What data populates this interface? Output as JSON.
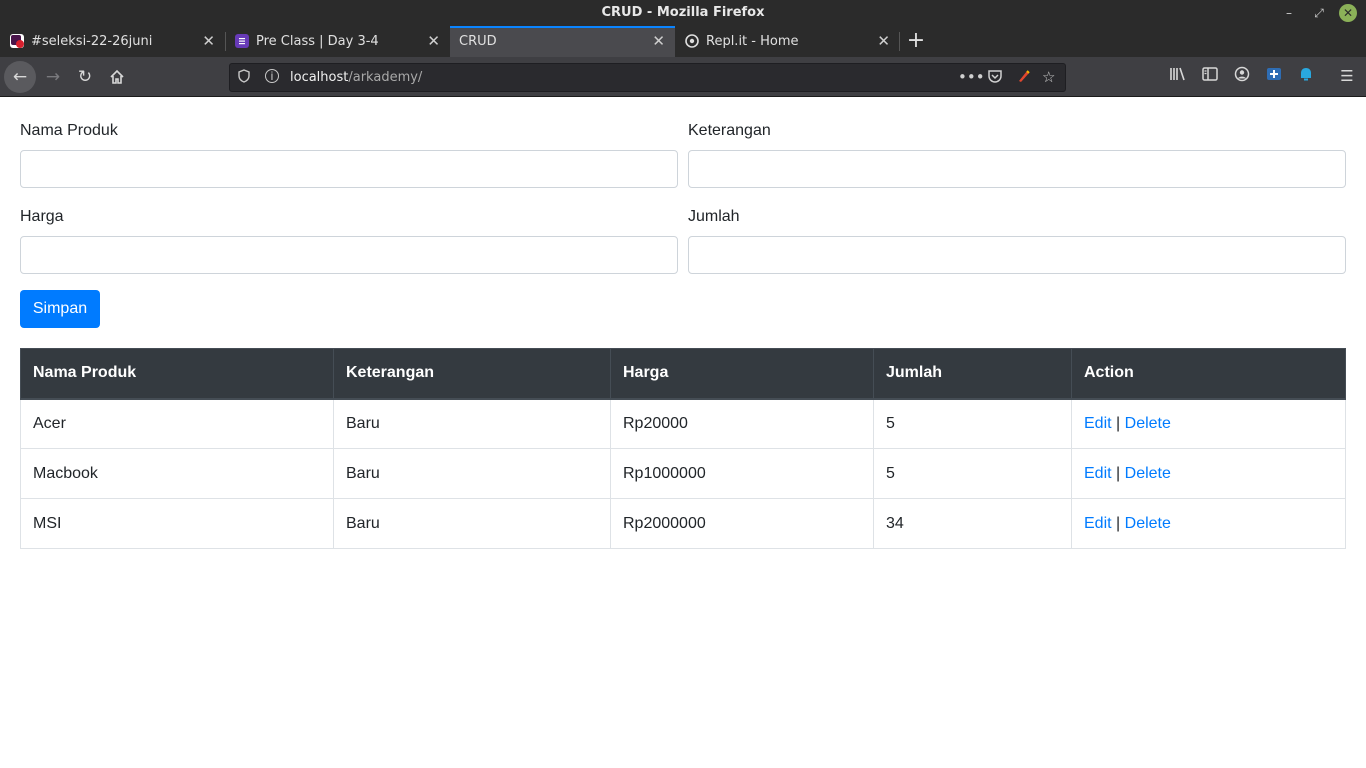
{
  "window": {
    "title": "CRUD - Mozilla Firefox",
    "controls": {
      "minimize": "–",
      "maximize": "⤢",
      "close": "✕"
    }
  },
  "tabs": [
    {
      "label": "#seleksi-22-26juni",
      "icon": "slack-channel-icon",
      "icon_color": "#d8202e"
    },
    {
      "label": "Pre Class | Day 3-4",
      "icon": "form-icon",
      "icon_color": "#673ab7"
    },
    {
      "label": "CRUD",
      "active": true
    },
    {
      "label": "Repl.it - Home",
      "icon": "replit-icon",
      "icon_color": "#dddddd"
    }
  ],
  "navbar": {
    "url_host": "localhost",
    "url_path": "/arkademy/",
    "library_badge": "0"
  },
  "form": {
    "fields": {
      "nama_produk": {
        "label": "Nama Produk",
        "value": ""
      },
      "keterangan": {
        "label": "Keterangan",
        "value": ""
      },
      "harga": {
        "label": "Harga",
        "value": ""
      },
      "jumlah": {
        "label": "Jumlah",
        "value": ""
      }
    },
    "submit_label": "Simpan"
  },
  "table": {
    "headers": [
      "Nama Produk",
      "Keterangan",
      "Harga",
      "Jumlah",
      "Action"
    ],
    "rows": [
      {
        "nama": "Acer",
        "keterangan": "Baru",
        "harga": "Rp20000",
        "jumlah": "5"
      },
      {
        "nama": "Macbook",
        "keterangan": "Baru",
        "harga": "Rp1000000",
        "jumlah": "5"
      },
      {
        "nama": "MSI",
        "keterangan": "Baru",
        "harga": "Rp2000000",
        "jumlah": "34"
      }
    ],
    "edit_label": "Edit",
    "separator": "|",
    "delete_label": "Delete"
  },
  "colors": {
    "primary": "#007bff",
    "table_header": "#343a40",
    "active_tab_accent": "#0a84ff"
  }
}
